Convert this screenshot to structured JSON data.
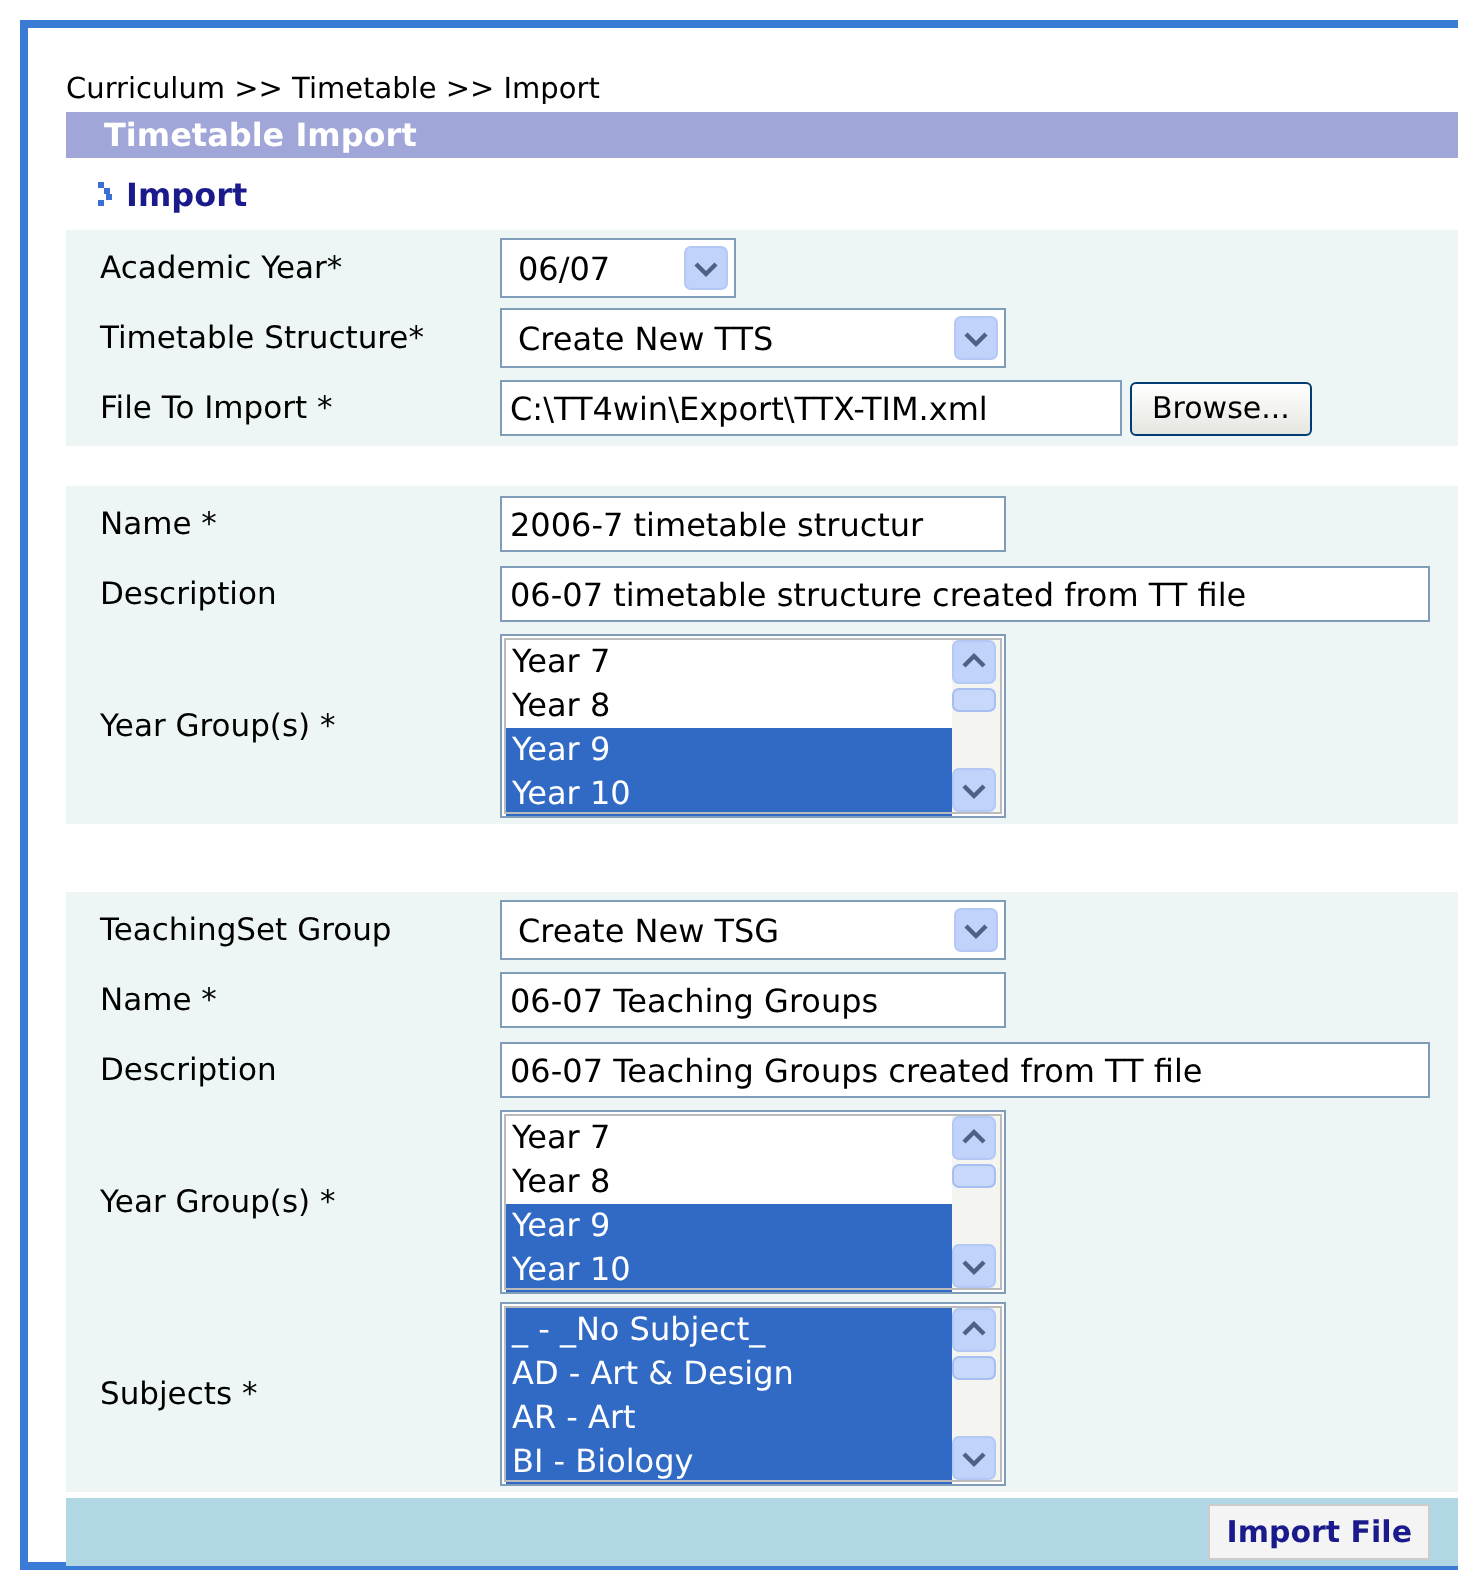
{
  "breadcrumb": "Curriculum >> Timetable >> Import",
  "title": "Timetable Import",
  "subheading": "Import",
  "sections": [
    {
      "fields": [
        {
          "kind": "select",
          "label": "Academic Year*",
          "value": "06/07"
        },
        {
          "kind": "select",
          "label": "Timetable Structure*",
          "value": "Create New TTS"
        },
        {
          "kind": "file",
          "label": "File To Import *",
          "value": "C:\\TT4win\\Export\\TTX-TIM.xml",
          "button": "Browse..."
        }
      ]
    },
    {
      "fields": [
        {
          "kind": "text",
          "label": "Name *",
          "value": "2006-7 timetable structur"
        },
        {
          "kind": "text",
          "label": "Description",
          "value": "06-07 timetable structure created from TT file"
        },
        {
          "kind": "listbox",
          "label": "Year Group(s) *",
          "options": [
            {
              "label": "Year 7",
              "selected": false
            },
            {
              "label": "Year 8",
              "selected": false
            },
            {
              "label": "Year 9",
              "selected": true
            },
            {
              "label": "Year 10",
              "selected": true
            }
          ]
        }
      ]
    },
    {
      "fields": [
        {
          "kind": "select",
          "label": "TeachingSet Group",
          "value": "Create New TSG"
        },
        {
          "kind": "text",
          "label": "Name *",
          "value": "06-07 Teaching Groups"
        },
        {
          "kind": "text",
          "label": "Description",
          "value": "06-07 Teaching Groups created from TT file"
        },
        {
          "kind": "listbox",
          "label": "Year Group(s) *",
          "options": [
            {
              "label": "Year 7",
              "selected": false
            },
            {
              "label": "Year 8",
              "selected": false
            },
            {
              "label": "Year 9",
              "selected": true
            },
            {
              "label": "Year 10",
              "selected": true
            }
          ]
        },
        {
          "kind": "listbox",
          "label": "Subjects *",
          "options": [
            {
              "label": "_ - _No Subject_",
              "selected": true
            },
            {
              "label": "AD - Art & Design",
              "selected": true
            },
            {
              "label": "AR - Art",
              "selected": true
            },
            {
              "label": "BI - Biology",
              "selected": true
            }
          ]
        }
      ]
    }
  ],
  "submit": "Import File"
}
